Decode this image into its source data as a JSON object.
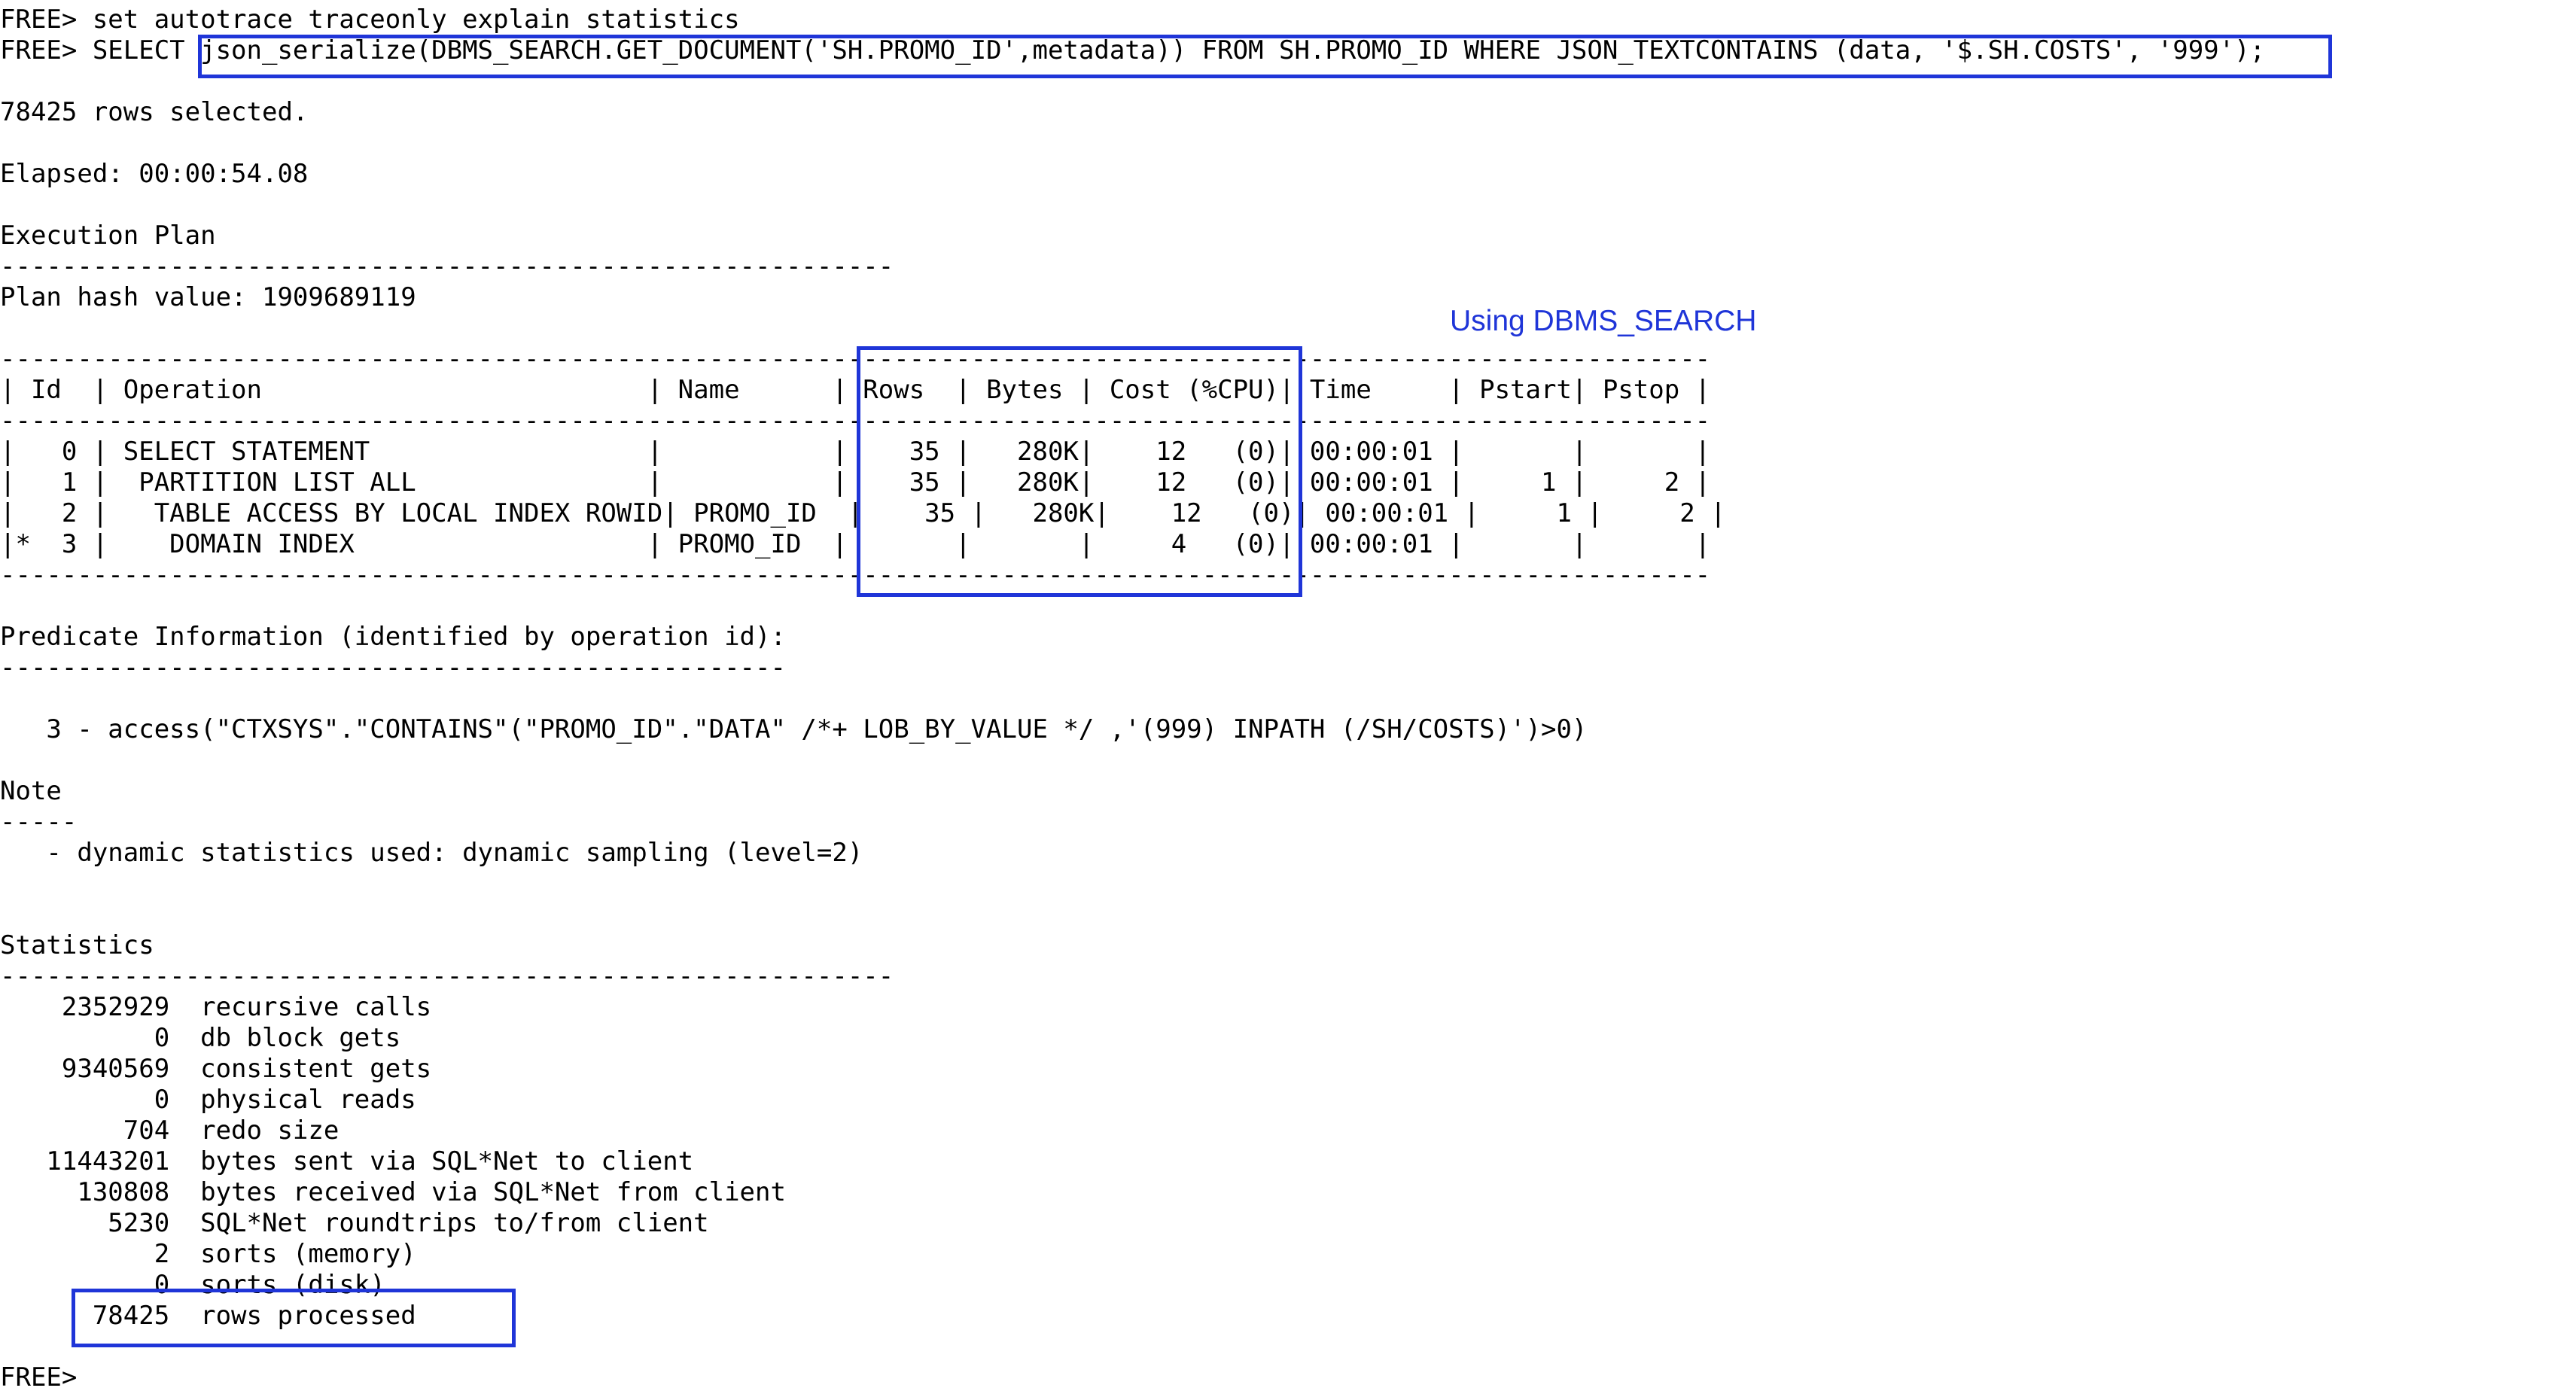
{
  "terminal": {
    "lines": [
      "FREE> set autotrace traceonly explain statistics",
      "FREE> SELECT json_serialize(DBMS_SEARCH.GET_DOCUMENT('SH.PROMO_ID',metadata)) FROM SH.PROMO_ID WHERE JSON_TEXTCONTAINS (data, '$.SH.COSTS', '999');",
      "",
      "78425 rows selected.",
      "",
      "Elapsed: 00:00:54.08",
      "",
      "Execution Plan",
      "----------------------------------------------------------",
      "Plan hash value: 1909689119",
      "",
      "---------------------------------------------------------------------------------------------------------------",
      "| Id  | Operation                         | Name      | Rows  | Bytes | Cost (%CPU)| Time     | Pstart| Pstop |",
      "---------------------------------------------------------------------------------------------------------------",
      "|   0 | SELECT STATEMENT                  |           |    35 |   280K|    12   (0)| 00:00:01 |       |       |",
      "|   1 |  PARTITION LIST ALL               |           |    35 |   280K|    12   (0)| 00:00:01 |     1 |     2 |",
      "|   2 |   TABLE ACCESS BY LOCAL INDEX ROWID| PROMO_ID  |    35 |   280K|    12   (0)| 00:00:01 |     1 |     2 |",
      "|*  3 |    DOMAIN INDEX                   | PROMO_ID  |       |       |     4   (0)| 00:00:01 |       |       |",
      "---------------------------------------------------------------------------------------------------------------",
      "",
      "Predicate Information (identified by operation id):",
      "---------------------------------------------------",
      "",
      "   3 - access(\"CTXSYS\".\"CONTAINS\"(\"PROMO_ID\".\"DATA\" /*+ LOB_BY_VALUE */ ,'(999) INPATH (/SH/COSTS)')>0)",
      "",
      "Note",
      "-----",
      "   - dynamic statistics used: dynamic sampling (level=2)",
      "",
      "",
      "Statistics",
      "----------------------------------------------------------",
      "    2352929  recursive calls",
      "          0  db block gets",
      "    9340569  consistent gets",
      "          0  physical reads",
      "        704  redo size",
      "   11443201  bytes sent via SQL*Net to client",
      "     130808  bytes received via SQL*Net from client",
      "       5230  SQL*Net roundtrips to/from client",
      "          2  sorts (memory)",
      "          0  sorts (disk)",
      "      78425  rows processed",
      "",
      "FREE>"
    ]
  },
  "annotation": {
    "label": "Using DBMS_SEARCH",
    "color": "#1f35d8"
  }
}
